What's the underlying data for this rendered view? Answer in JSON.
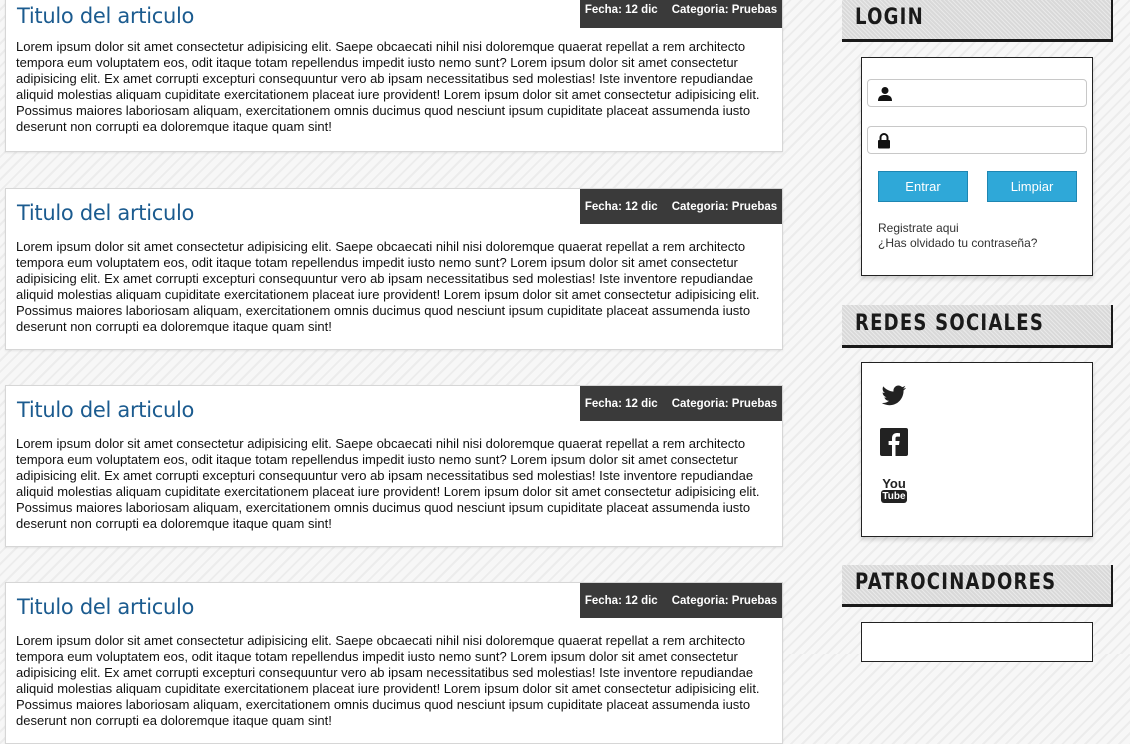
{
  "articles": [
    {
      "title": "Titulo del articulo",
      "date": "Fecha: 12 dic",
      "category": "Categoria: Pruebas",
      "body": "Lorem ipsum dolor sit amet consectetur adipisicing elit. Saepe obcaecati nihil nisi doloremque quaerat repellat a rem architecto tempora eum voluptatem eos, odit itaque totam repellendus impedit iusto nemo sunt? Lorem ipsum dolor sit amet consectetur adipisicing elit. Ex amet corrupti excepturi consequuntur vero ab ipsam necessitatibus sed molestias! Iste inventore repudiandae aliquid molestias aliquam cupiditate exercitationem placeat iure provident! Lorem ipsum dolor sit amet consectetur adipisicing elit. Possimus maiores laboriosam aliquam, exercitationem omnis ducimus quod nesciunt ipsum cupiditate placeat assumenda iusto deserunt non corrupti ea doloremque itaque quam sint!"
    },
    {
      "title": "Titulo del articulo",
      "date": "Fecha: 12 dic",
      "category": "Categoria: Pruebas",
      "body": "Lorem ipsum dolor sit amet consectetur adipisicing elit. Saepe obcaecati nihil nisi doloremque quaerat repellat a rem architecto tempora eum voluptatem eos, odit itaque totam repellendus impedit iusto nemo sunt? Lorem ipsum dolor sit amet consectetur adipisicing elit. Ex amet corrupti excepturi consequuntur vero ab ipsam necessitatibus sed molestias! Iste inventore repudiandae aliquid molestias aliquam cupiditate exercitationem placeat iure provident! Lorem ipsum dolor sit amet consectetur adipisicing elit. Possimus maiores laboriosam aliquam, exercitationem omnis ducimus quod nesciunt ipsum cupiditate placeat assumenda iusto deserunt non corrupti ea doloremque itaque quam sint!"
    },
    {
      "title": "Titulo del articulo",
      "date": "Fecha: 12 dic",
      "category": "Categoria: Pruebas",
      "body": "Lorem ipsum dolor sit amet consectetur adipisicing elit. Saepe obcaecati nihil nisi doloremque quaerat repellat a rem architecto tempora eum voluptatem eos, odit itaque totam repellendus impedit iusto nemo sunt? Lorem ipsum dolor sit amet consectetur adipisicing elit. Ex amet corrupti excepturi consequuntur vero ab ipsam necessitatibus sed molestias! Iste inventore repudiandae aliquid molestias aliquam cupiditate exercitationem placeat iure provident! Lorem ipsum dolor sit amet consectetur adipisicing elit. Possimus maiores laboriosam aliquam, exercitationem omnis ducimus quod nesciunt ipsum cupiditate placeat assumenda iusto deserunt non corrupti ea doloremque itaque quam sint!"
    },
    {
      "title": "Titulo del articulo",
      "date": "Fecha: 12 dic",
      "category": "Categoria: Pruebas",
      "body": "Lorem ipsum dolor sit amet consectetur adipisicing elit. Saepe obcaecati nihil nisi doloremque quaerat repellat a rem architecto tempora eum voluptatem eos, odit itaque totam repellendus impedit iusto nemo sunt? Lorem ipsum dolor sit amet consectetur adipisicing elit. Ex amet corrupti excepturi consequuntur vero ab ipsam necessitatibus sed molestias! Iste inventore repudiandae aliquid molestias aliquam cupiditate exercitationem placeat iure provident! Lorem ipsum dolor sit amet consectetur adipisicing elit. Possimus maiores laboriosam aliquam, exercitationem omnis ducimus quod nesciunt ipsum cupiditate placeat assumenda iusto deserunt non corrupti ea doloremque itaque quam sint!"
    }
  ],
  "login": {
    "heading": "LOGIN",
    "username_icon": "user-icon",
    "password_icon": "lock-icon",
    "enter_label": "Entrar",
    "clear_label": "Limpiar",
    "register_link": "Registrate aqui",
    "forgot_link": "¿Has olvidado tu contraseña?"
  },
  "social": {
    "heading": "REDES SOCIALES",
    "icons": [
      "twitter-icon",
      "facebook-icon",
      "youtube-icon"
    ],
    "youtube_text_top": "You",
    "youtube_text_bottom": "Tube"
  },
  "sponsors": {
    "heading": "PATROCINADORES"
  },
  "colors": {
    "title": "#1b5b8f",
    "meta_bg": "#3a3a3a",
    "button": "#2fa8d8",
    "text": "#111111"
  }
}
